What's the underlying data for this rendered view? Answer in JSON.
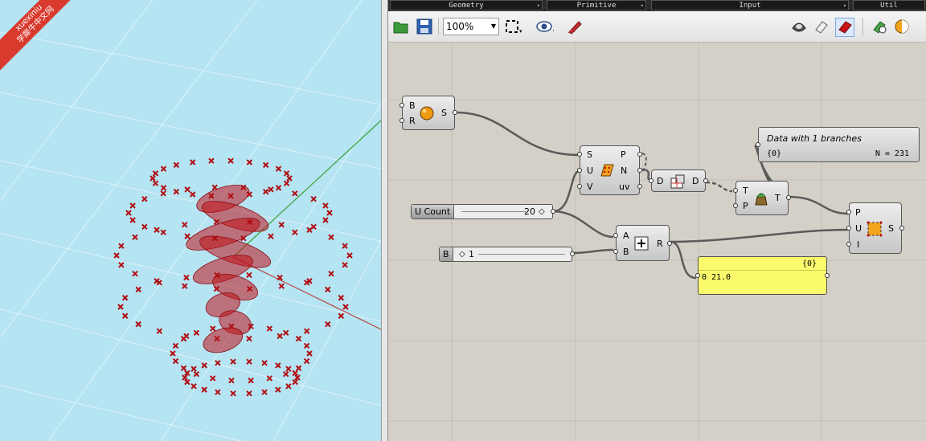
{
  "watermark": {
    "line1": "xuexiniu",
    "line2": "学犀牛中文网"
  },
  "tabs": [
    "Geometry",
    "Primitive",
    "Input",
    "Util"
  ],
  "toolbar": {
    "zoom": "100%"
  },
  "components": {
    "sphere": {
      "inputs": [
        "B",
        "R"
      ],
      "output": "S"
    },
    "divide_surface": {
      "inputs": [
        "S",
        "U",
        "V"
      ],
      "outputs": [
        "P",
        "N",
        "uv"
      ]
    },
    "data": {
      "input": "D",
      "output": "D"
    },
    "shift": {
      "inputs": [
        "T",
        "P"
      ],
      "output": "T"
    },
    "addition": {
      "inputs": [
        "A",
        "B"
      ],
      "output": "R"
    },
    "evaluate": {
      "inputs": [
        "P",
        "U",
        "I"
      ],
      "output": "S"
    }
  },
  "sliders": {
    "u_count": {
      "name": "U Count",
      "value": "20"
    },
    "b": {
      "name": "B",
      "value": "1"
    }
  },
  "param_viewer": {
    "title": "Data with 1 branches",
    "path": "{0}",
    "count": "N = 231"
  },
  "panel": {
    "path": "{0}",
    "index": "0",
    "value": "21.0"
  },
  "colors": {
    "viewport": "#b5e4f2",
    "canvas": "#d4d0c8",
    "points": "#b00d12",
    "panel": "#fafa6c"
  }
}
